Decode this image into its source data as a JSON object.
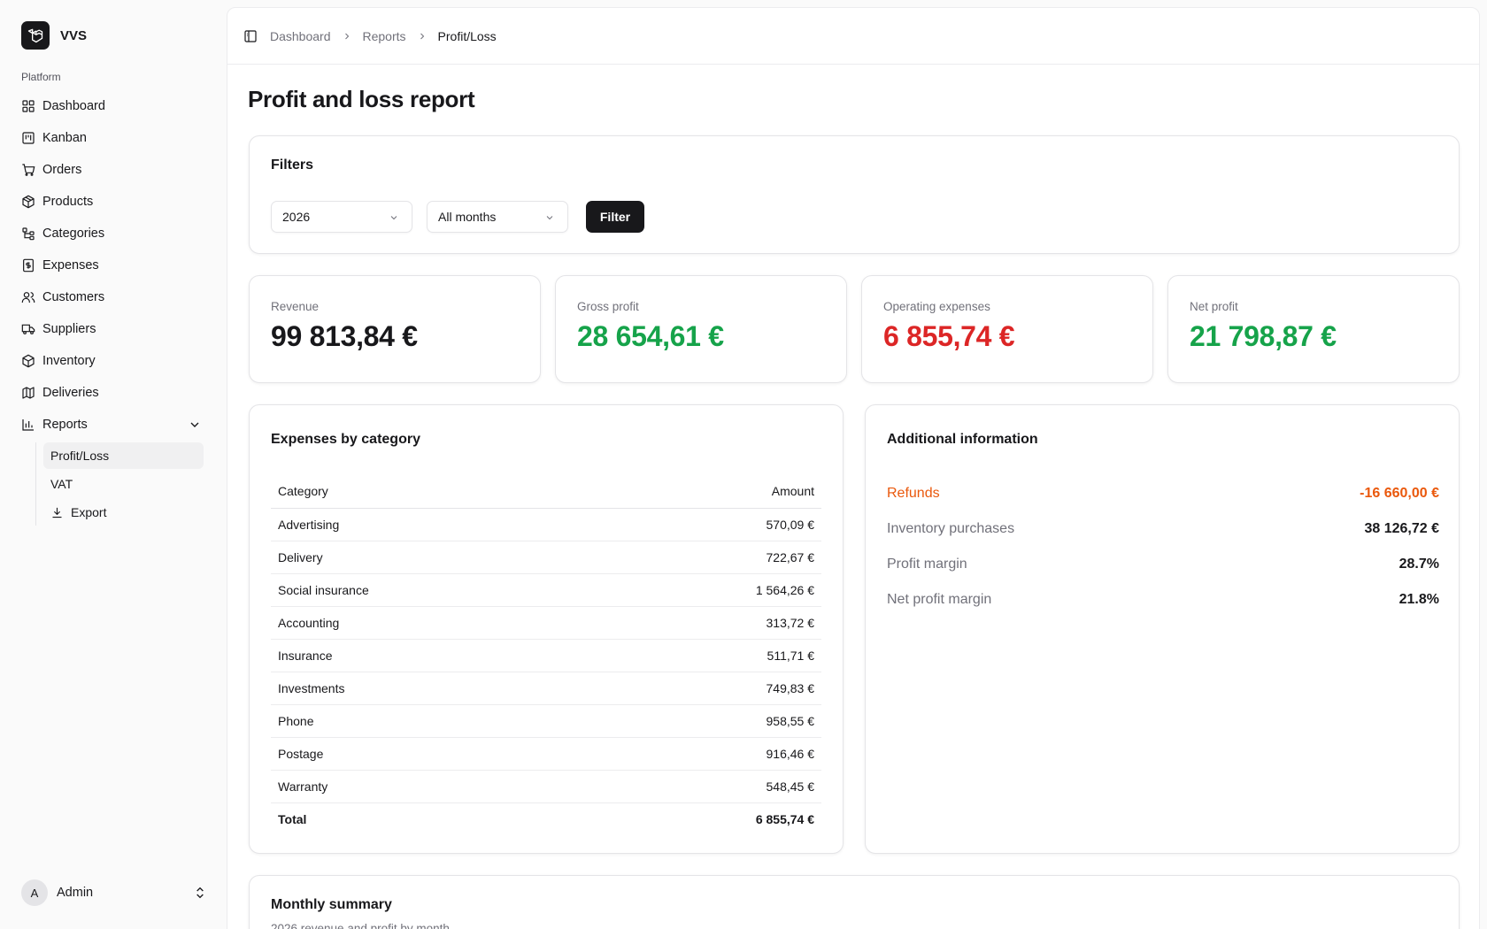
{
  "brand": {
    "name": "VVS"
  },
  "sidebar": {
    "section_label": "Platform",
    "items": [
      {
        "label": "Dashboard",
        "icon": "grid-icon"
      },
      {
        "label": "Kanban",
        "icon": "kanban-icon"
      },
      {
        "label": "Orders",
        "icon": "cart-icon"
      },
      {
        "label": "Products",
        "icon": "package-icon"
      },
      {
        "label": "Categories",
        "icon": "tree-icon"
      },
      {
        "label": "Expenses",
        "icon": "receipt-icon"
      },
      {
        "label": "Customers",
        "icon": "users-icon"
      },
      {
        "label": "Suppliers",
        "icon": "truck-icon"
      },
      {
        "label": "Inventory",
        "icon": "box-icon"
      },
      {
        "label": "Deliveries",
        "icon": "map-icon"
      },
      {
        "label": "Reports",
        "icon": "bar-chart-icon"
      }
    ],
    "reports_sub": [
      {
        "label": "Profit/Loss",
        "active": true
      },
      {
        "label": "VAT"
      },
      {
        "label": "Export",
        "icon": "download-icon"
      }
    ]
  },
  "user": {
    "initial": "A",
    "name": "Admin"
  },
  "breadcrumb": {
    "items": [
      "Dashboard",
      "Reports",
      "Profit/Loss"
    ]
  },
  "page": {
    "title": "Profit and loss report"
  },
  "filters": {
    "title": "Filters",
    "year": "2026",
    "month": "All months",
    "button": "Filter"
  },
  "stats": [
    {
      "label": "Revenue",
      "value": "99 813,84 €",
      "color": "#18181b"
    },
    {
      "label": "Gross profit",
      "value": "28 654,61 €",
      "color": "#16a34a"
    },
    {
      "label": "Operating expenses",
      "value": "6 855,74 €",
      "color": "#dc2626"
    },
    {
      "label": "Net profit",
      "value": "21 798,87 €",
      "color": "#16a34a"
    }
  ],
  "expenses": {
    "title": "Expenses by category",
    "headers": {
      "category": "Category",
      "amount": "Amount"
    },
    "rows": [
      {
        "category": "Advertising",
        "amount": "570,09 €"
      },
      {
        "category": "Delivery",
        "amount": "722,67 €"
      },
      {
        "category": "Social insurance",
        "amount": "1 564,26 €"
      },
      {
        "category": "Accounting",
        "amount": "313,72 €"
      },
      {
        "category": "Insurance",
        "amount": "511,71 €"
      },
      {
        "category": "Investments",
        "amount": "749,83 €"
      },
      {
        "category": "Phone",
        "amount": "958,55 €"
      },
      {
        "category": "Postage",
        "amount": "916,46 €"
      },
      {
        "category": "Warranty",
        "amount": "548,45 €"
      }
    ],
    "total": {
      "label": "Total",
      "amount": "6 855,74 €"
    }
  },
  "additional": {
    "title": "Additional information",
    "rows": [
      {
        "label": "Refunds",
        "value": "-16 660,00 €",
        "color": "#ea580c"
      },
      {
        "label": "Inventory purchases",
        "value": "38 126,72 €"
      },
      {
        "label": "Profit margin",
        "value": "28.7%"
      },
      {
        "label": "Net profit margin",
        "value": "21.8%"
      }
    ]
  },
  "monthly": {
    "title": "Monthly summary",
    "subtitle": "2026 revenue and profit by month"
  }
}
